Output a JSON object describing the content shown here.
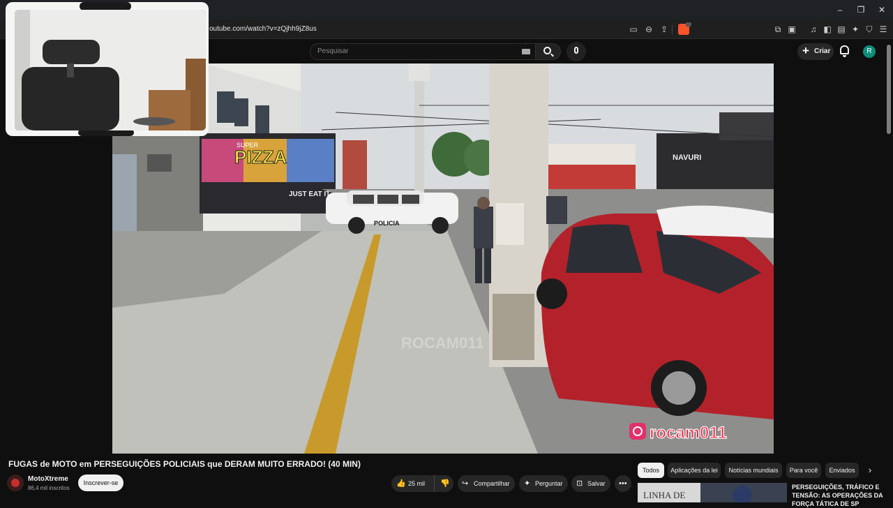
{
  "browser": {
    "url": "outube.com/watch?v=zQjhh9jZ8us",
    "window_controls": [
      "minimize",
      "maximize",
      "close"
    ],
    "minimize_glyph": "–",
    "maximize_glyph": "❐",
    "close_glyph": "✕"
  },
  "header": {
    "search_placeholder": "Pesquisar",
    "create_label": "Criar",
    "create_glyph": "+",
    "avatar_letter": "R",
    "avatar_color": "#0b8f7a"
  },
  "video": {
    "overlay_brand": "rocam011",
    "watermark": "ROCAM011",
    "police_label": "POLICIA",
    "store_name": "NAVURI",
    "graffiti_text": "PIZZA",
    "graffiti_small": "SUPER",
    "graffiti_just": "JUST EAT IT"
  },
  "info": {
    "title": "FUGAS de MOTO em PERSEGUIÇÕES POLICIAIS que DERAM MUITO ERRADO! (40 MIN)",
    "channel_name": "MotoXtreme",
    "channel_subs": "86,4 mil inscritos",
    "subscribe_label": "Inscrever-se",
    "like_count": "25 mil",
    "share_label": "Compartilhar",
    "ask_label": "Perguntar",
    "save_label": "Salvar"
  },
  "chips": [
    "Todos",
    "Aplicações da lei",
    "Notícias mundiais",
    "Para você",
    "Enviados"
  ],
  "recommended": {
    "title": "PERSEGUIÇÕES, TRÁFICO E TENSÃO: AS OPERAÇÕES DA FORÇA TÁTICA DE SP",
    "thumb_text": "LINHA DE"
  },
  "colors": {
    "accent": "#3ea6ff",
    "brand_red": "#ff0033",
    "car_red": "#b3212a"
  }
}
